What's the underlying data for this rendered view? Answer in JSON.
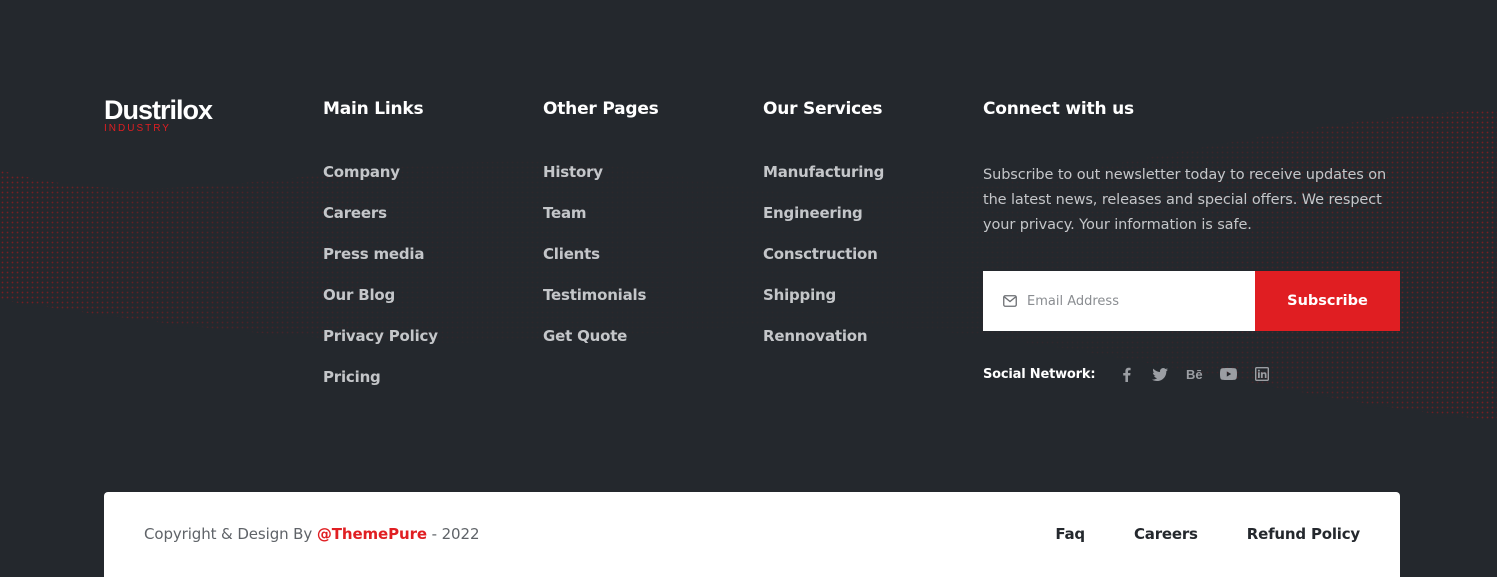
{
  "logo": {
    "name": "Dustrilox",
    "tagline": "INDUSTRY"
  },
  "columns": [
    {
      "title": "Main Links",
      "links": [
        "Company",
        "Careers",
        "Press media",
        "Our Blog",
        "Privacy Policy",
        "Pricing"
      ]
    },
    {
      "title": "Other Pages",
      "links": [
        "History",
        "Team",
        "Clients",
        "Testimonials",
        "Get Quote"
      ]
    },
    {
      "title": "Our Services",
      "links": [
        "Manufacturing",
        "Engineering",
        "Consctruction",
        "Shipping",
        "Rennovation"
      ]
    }
  ],
  "connect": {
    "title": "Connect with us",
    "text": "Subscribe to out newsletter today to receive updates on the latest news, releases and special offers. We respect your privacy. Your information is safe.",
    "email_placeholder": "Email Address",
    "subscribe_label": "Subscribe",
    "social_label": "Social Network:",
    "social_icons": [
      "facebook-icon",
      "twitter-icon",
      "behance-icon",
      "youtube-icon",
      "linkedin-icon"
    ]
  },
  "bottom": {
    "copyright_prefix": "Copyright & Design By ",
    "brand": "@ThemePure",
    "copyright_suffix": " - 2022",
    "links": [
      "Faq",
      "Careers",
      "Refund Policy"
    ]
  },
  "colors": {
    "background": "#24282d",
    "accent": "#e01e22",
    "bottom_bar": "#ffffff"
  }
}
